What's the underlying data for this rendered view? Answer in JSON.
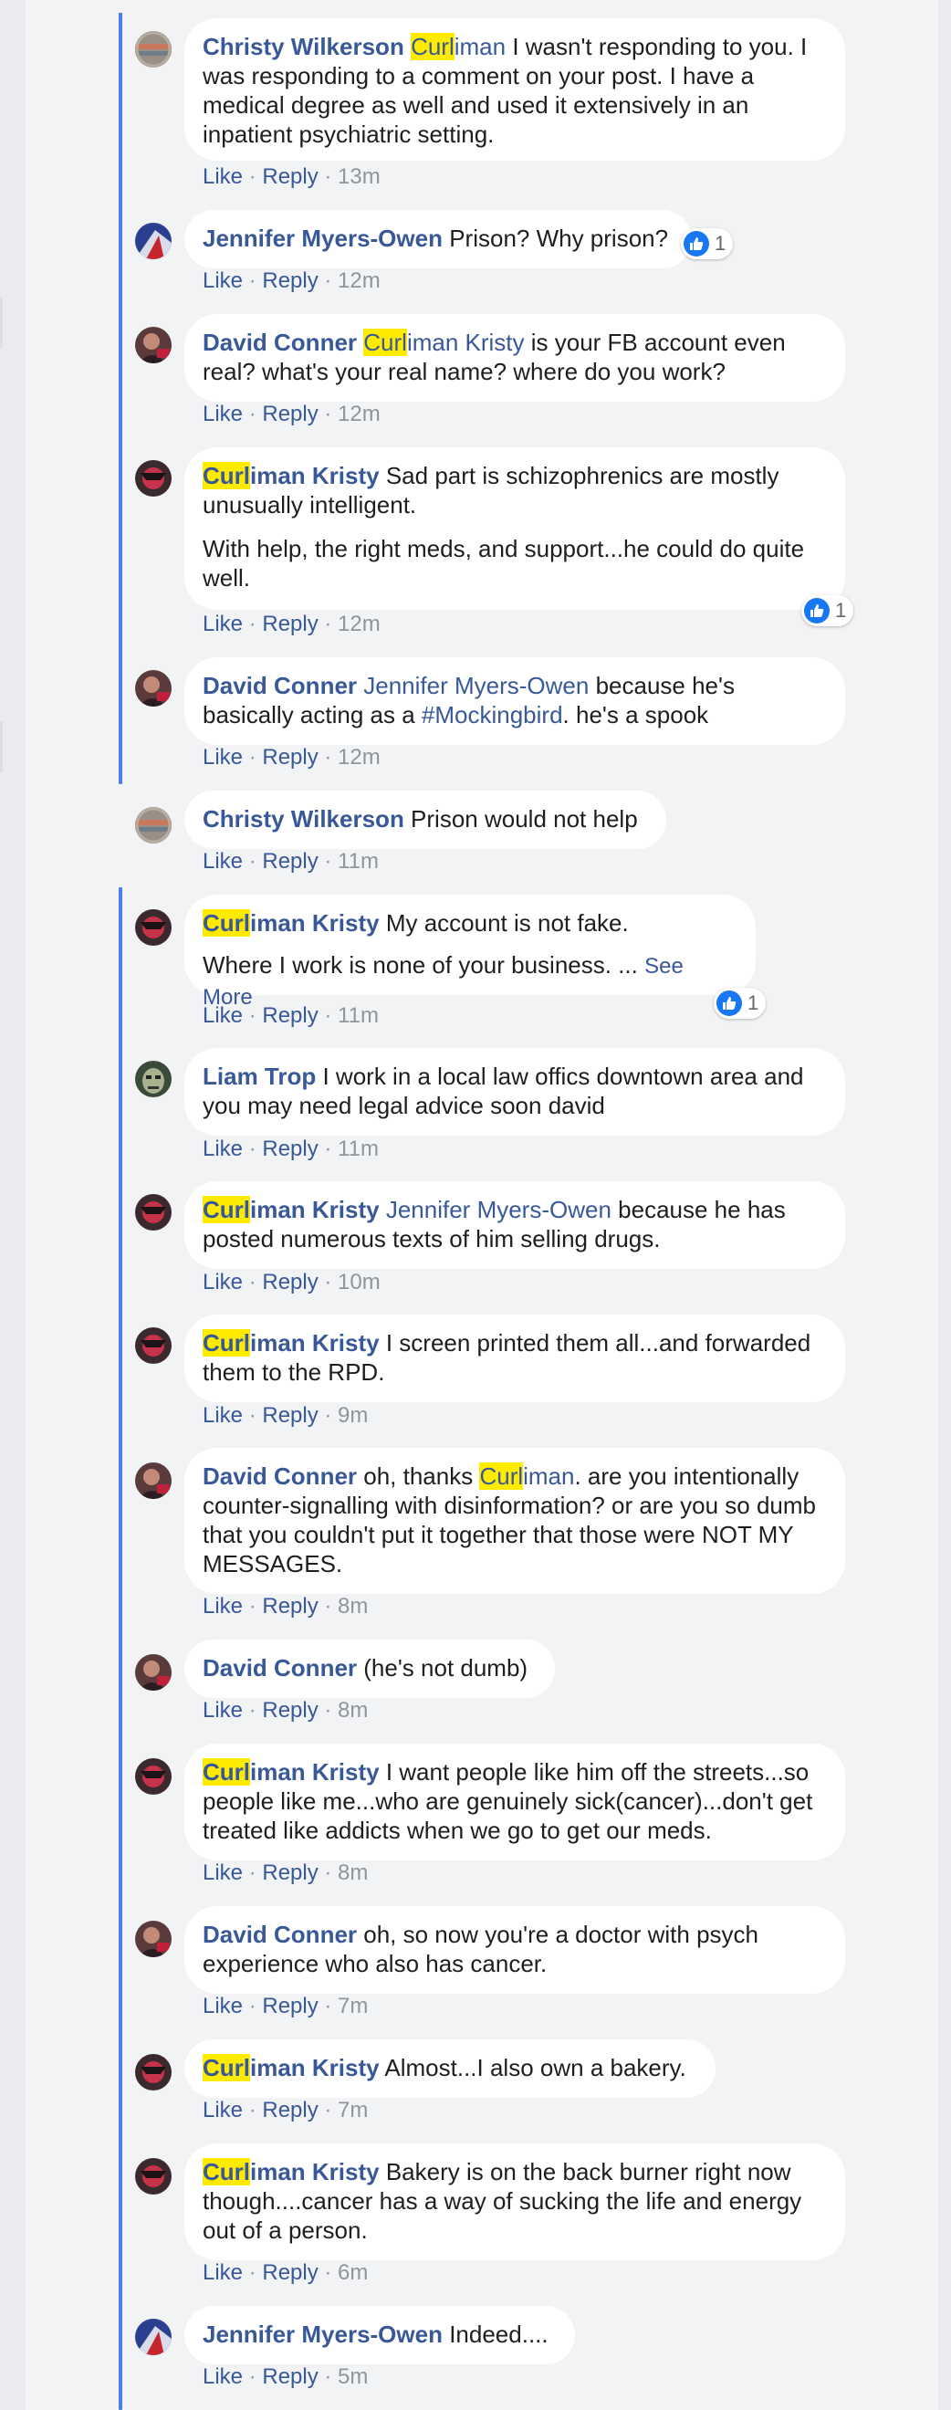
{
  "actions": {
    "like": "Like",
    "reply": "Reply",
    "sep": " · "
  },
  "comments": [
    {
      "id": "c1",
      "avatar": "christy",
      "name_parts": [
        [
          "name-link-hl",
          "Curl"
        ]
      ],
      "time": "13m"
    },
    {
      "id": "c2",
      "avatar": "jennifer",
      "time": "12m",
      "reaction": "1"
    },
    {
      "id": "c3",
      "avatar": "david",
      "time": "12m"
    },
    {
      "id": "c4",
      "avatar": "kristy",
      "time": "12m",
      "reaction": "1"
    },
    {
      "id": "c5",
      "avatar": "david",
      "time": "12m"
    },
    {
      "id": "c6",
      "avatar": "christy",
      "time": "11m"
    },
    {
      "id": "c7",
      "avatar": "kristy",
      "time": "11m",
      "reaction": "1"
    },
    {
      "id": "c8",
      "avatar": "liam",
      "time": "11m"
    },
    {
      "id": "c9",
      "avatar": "kristy",
      "time": "10m"
    },
    {
      "id": "c10",
      "avatar": "kristy",
      "time": "9m"
    },
    {
      "id": "c11",
      "avatar": "david",
      "time": "8m"
    },
    {
      "id": "c12",
      "avatar": "david",
      "time": "8m"
    },
    {
      "id": "c13",
      "avatar": "kristy",
      "time": "8m"
    },
    {
      "id": "c14",
      "avatar": "david",
      "time": "7m"
    },
    {
      "id": "c15",
      "avatar": "kristy",
      "time": "7m"
    },
    {
      "id": "c16",
      "avatar": "kristy",
      "time": "6m"
    },
    {
      "id": "c17",
      "avatar": "jennifer",
      "time": "5m"
    }
  ],
  "text": {
    "christy_wilkerson": "Christy Wilkerson",
    "jennifer_myers_owen": "Jennifer Myers-Owen",
    "david_conner": "David Conner",
    "curl": "Curl",
    "iman": "iman",
    "iman_kristy": "iman Kristy",
    "liam_trop": "Liam Trop",
    "c1_body": " I wasn't responding to you. I was responding to a comment on your post. I have a medical degree as well and used it extensively in an inpatient psychiatric setting.",
    "c2_body": " Prison? Why prison?",
    "c3_body": " is your FB account even real? what's your real name? where do you work?",
    "c4_body": " Sad part is schizophrenics are mostly unusually intelligent.",
    "c4_body2": "With help, the right meds, and support...he could do quite well.",
    "c5_mid": " because he's basically acting as a ",
    "c5_tag": "#Mockingbird",
    "c5_end": ". he's a spook",
    "c6_body": " Prison would not help",
    "c7_body": " My account is not fake.",
    "c7_body2": "Where I work is none of your business. ... ",
    "see_more": "See More",
    "c8_body": " I work in a local law offics downtown area and you may need legal advice soon david",
    "c9_body": " because he has posted numerous texts of him selling drugs.",
    "c10_body": " I screen printed them all...and forwarded them to the RPD.",
    "c11_pre": " oh, thanks ",
    "c11_body": ". are you intentionally counter-signalling with disinformation? or are you so dumb that you couldn't put it together that those were NOT MY MESSAGES.",
    "c12_body": " (he's not dumb)",
    "c13_body": " I want people like him off the streets...so people like me...who are genuinely sick(cancer)...don't get treated like addicts when we go to get our meds.",
    "c14_body": " oh, so now you're a doctor with psych experience who also has cancer.",
    "c15_body": " Almost...I also own a bakery.",
    "c16_body": " Bakery is on the back burner right now though....cancer has a way of sucking the life and energy out of a person.",
    "c17_body": " Indeed...."
  },
  "colors": {
    "link": "#385898",
    "highlight": "#ffeb00",
    "thread": "#4a7fe8",
    "like_blue": "#1877f2"
  }
}
